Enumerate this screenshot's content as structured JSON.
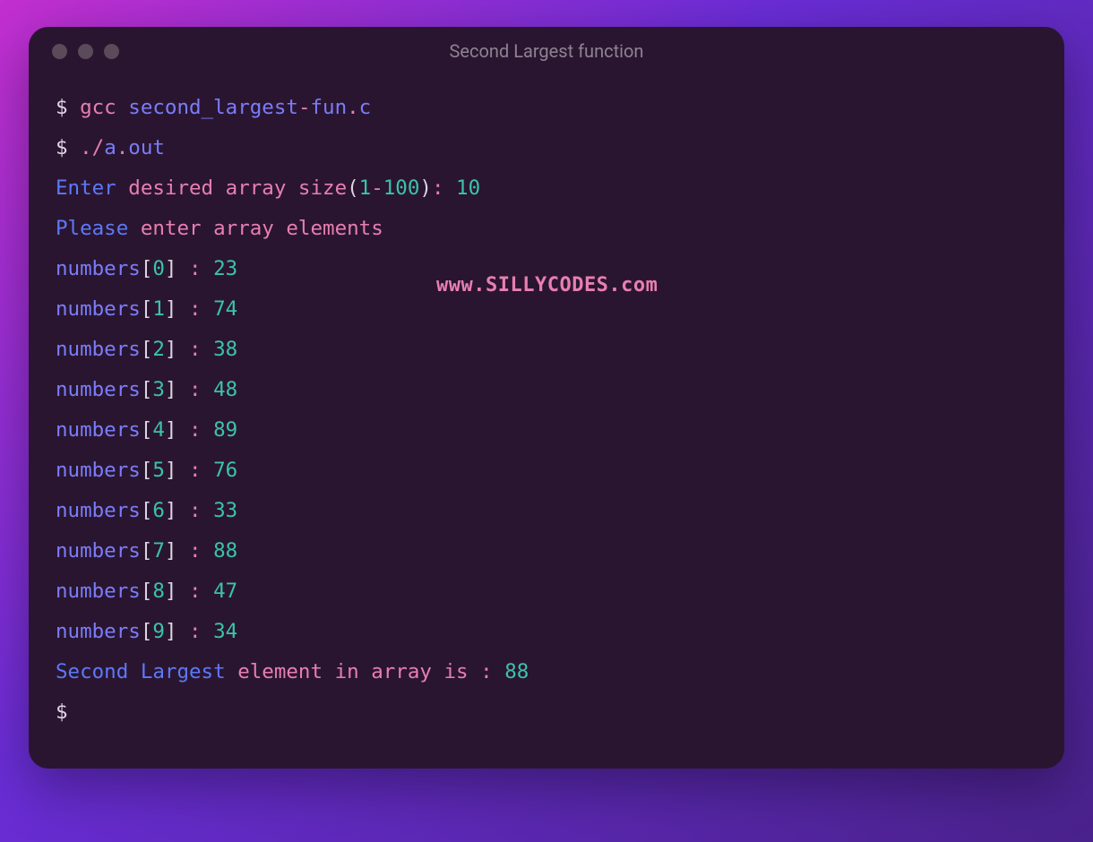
{
  "window": {
    "title": "Second Largest function"
  },
  "watermark": "www.SILLYCODES.com",
  "cmd1": {
    "prompt": "$ ",
    "tool": "gcc ",
    "file": "second_largest",
    "dash": "-",
    "rest": "fun",
    "dot": ".",
    "ext": "c"
  },
  "cmd2": {
    "prompt": "$ ",
    "dotslash": "./",
    "a": "a",
    "dot2": ".",
    "out": "out"
  },
  "enter_line": {
    "w1": "Enter ",
    "w2": "desired array size",
    "paren_o": "(",
    "one": "1",
    "dash": "-",
    "hund": "100",
    "paren_c": ")",
    "colon": ": ",
    "val": "10"
  },
  "please_line": {
    "w1": "Please ",
    "w2": "enter array elements"
  },
  "rows": [
    {
      "idx": "0",
      "val": "23"
    },
    {
      "idx": "1",
      "val": "74"
    },
    {
      "idx": "2",
      "val": "38"
    },
    {
      "idx": "3",
      "val": "48"
    },
    {
      "idx": "4",
      "val": "89"
    },
    {
      "idx": "5",
      "val": "76"
    },
    {
      "idx": "6",
      "val": "33"
    },
    {
      "idx": "7",
      "val": "88"
    },
    {
      "idx": "8",
      "val": "47"
    },
    {
      "idx": "9",
      "val": "34"
    }
  ],
  "row_parts": {
    "numbers": "numbers",
    "lb": "[",
    "rb": "]",
    "sep": " : "
  },
  "result": {
    "w1": "Second Largest ",
    "w2": "element in array is ",
    "colon": ": ",
    "val": "88"
  },
  "last_prompt": "$ "
}
